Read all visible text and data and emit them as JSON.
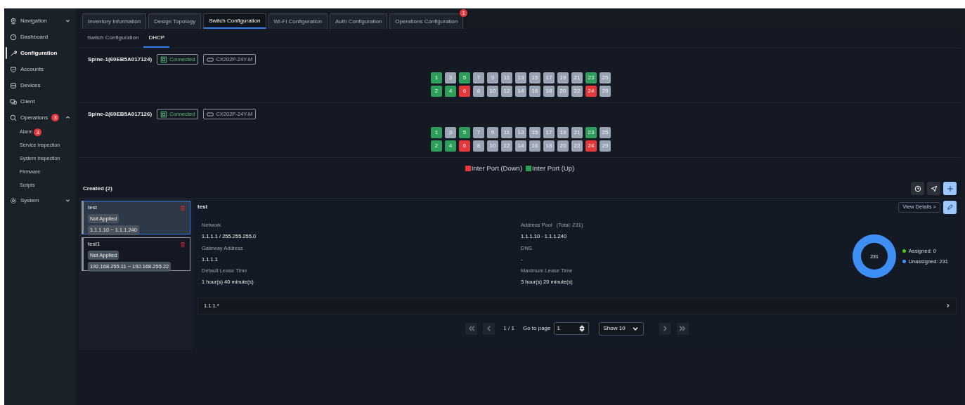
{
  "sidebar": {
    "items": [
      {
        "label": "Navigation",
        "kind": "group",
        "expanded": false,
        "selected": false
      },
      {
        "label": "Dashboard",
        "kind": "link",
        "selected": false
      },
      {
        "label": "Configuration",
        "kind": "link",
        "selected": true
      },
      {
        "label": "Accounts",
        "kind": "link",
        "selected": false
      },
      {
        "label": "Devices",
        "kind": "link",
        "selected": false
      },
      {
        "label": "Client",
        "kind": "link",
        "selected": false
      },
      {
        "label": "Operations",
        "kind": "group",
        "badge": "3",
        "expanded": true,
        "selected": false,
        "children": [
          {
            "label": "Alarm",
            "badge": "3",
            "selected": false
          },
          {
            "label": "Service Inspection",
            "selected": false
          },
          {
            "label": "System Inspection",
            "selected": false
          },
          {
            "label": "Firmware",
            "selected": false
          },
          {
            "label": "Scripts",
            "selected": false
          }
        ]
      },
      {
        "label": "System",
        "kind": "group",
        "expanded": false,
        "selected": false
      }
    ]
  },
  "tabs": [
    {
      "label": "Inventory Information",
      "selected": false
    },
    {
      "label": "Design Topology",
      "selected": false
    },
    {
      "label": "Switch Configuration",
      "selected": true
    },
    {
      "label": "Wi-Fi Configuration",
      "selected": false
    },
    {
      "label": "Auth Configuration",
      "selected": false
    },
    {
      "label": "Operations Configuration",
      "selected": false,
      "badge": "1"
    }
  ],
  "subtabs": [
    {
      "label": "Switch Configuration",
      "selected": false
    },
    {
      "label": "DHCP",
      "selected": true
    }
  ],
  "switches": [
    {
      "name": "Spine-1(60EB5A017124)",
      "status": "Connected",
      "model": "CX202P-24Y-M",
      "ports": [
        {
          "label": "1",
          "color": "#2e9e5b"
        },
        {
          "label": "2",
          "color": "#2e9e5b"
        },
        {
          "label": "3",
          "color": "#9ba4b3"
        },
        {
          "label": "4",
          "color": "#2e9e5b"
        },
        {
          "label": "5",
          "color": "#2e9e5b"
        },
        {
          "label": "6",
          "color": "#e5383b"
        },
        {
          "label": "7",
          "color": "#9ba4b3"
        },
        {
          "label": "8",
          "color": "#9ba4b3"
        },
        {
          "label": "9",
          "color": "#9ba4b3"
        },
        {
          "label": "10",
          "color": "#9ba4b3"
        },
        {
          "label": "11",
          "color": "#9ba4b3"
        },
        {
          "label": "12",
          "color": "#9ba4b3"
        },
        {
          "label": "13",
          "color": "#9ba4b3"
        },
        {
          "label": "14",
          "color": "#9ba4b3"
        },
        {
          "label": "15",
          "color": "#9ba4b3"
        },
        {
          "label": "16",
          "color": "#9ba4b3"
        },
        {
          "label": "17",
          "color": "#9ba4b3"
        },
        {
          "label": "18",
          "color": "#9ba4b3"
        },
        {
          "label": "19",
          "color": "#9ba4b3"
        },
        {
          "label": "20",
          "color": "#9ba4b3"
        },
        {
          "label": "21",
          "color": "#9ba4b3"
        },
        {
          "label": "22",
          "color": "#9ba4b3"
        },
        {
          "label": "23",
          "color": "#2e9e5b"
        },
        {
          "label": "24",
          "color": "#e5383b"
        },
        {
          "label": "25",
          "color": "#9ba4b3"
        },
        {
          "label": "29",
          "color": "#9ba4b3"
        }
      ]
    },
    {
      "name": "Spine-2(60EB5A017126)",
      "status": "Connected",
      "model": "CX202P-24Y-M",
      "ports": [
        {
          "label": "1",
          "color": "#2e9e5b"
        },
        {
          "label": "2",
          "color": "#2e9e5b"
        },
        {
          "label": "3",
          "color": "#9ba4b3"
        },
        {
          "label": "4",
          "color": "#2e9e5b"
        },
        {
          "label": "5",
          "color": "#2e9e5b"
        },
        {
          "label": "6",
          "color": "#e5383b"
        },
        {
          "label": "7",
          "color": "#9ba4b3"
        },
        {
          "label": "8",
          "color": "#9ba4b3"
        },
        {
          "label": "9",
          "color": "#9ba4b3"
        },
        {
          "label": "10",
          "color": "#9ba4b3"
        },
        {
          "label": "11",
          "color": "#9ba4b3"
        },
        {
          "label": "12",
          "color": "#9ba4b3"
        },
        {
          "label": "13",
          "color": "#9ba4b3"
        },
        {
          "label": "14",
          "color": "#9ba4b3"
        },
        {
          "label": "15",
          "color": "#9ba4b3"
        },
        {
          "label": "16",
          "color": "#9ba4b3"
        },
        {
          "label": "17",
          "color": "#9ba4b3"
        },
        {
          "label": "18",
          "color": "#9ba4b3"
        },
        {
          "label": "19",
          "color": "#9ba4b3"
        },
        {
          "label": "20",
          "color": "#9ba4b3"
        },
        {
          "label": "21",
          "color": "#9ba4b3"
        },
        {
          "label": "22",
          "color": "#9ba4b3"
        },
        {
          "label": "23",
          "color": "#2e9e5b"
        },
        {
          "label": "24",
          "color": "#e5383b"
        },
        {
          "label": "25",
          "color": "#9ba4b3"
        },
        {
          "label": "29",
          "color": "#9ba4b3"
        }
      ]
    }
  ],
  "legend": [
    {
      "label": "Inter Port (Down)",
      "color": "#e5383b"
    },
    {
      "label": "Inter Port (Up)",
      "color": "#2e9e5b"
    }
  ],
  "created": {
    "title": "Created (2)",
    "pools": [
      {
        "name": "test",
        "status": "Not Applied",
        "range": "1.1.1.10 ~ 1.1.1.240",
        "selected": true
      },
      {
        "name": "test1",
        "status": "Not Applied",
        "range": "192.168.255.11 ~ 192.168.255.22",
        "selected": false
      }
    ]
  },
  "detail": {
    "title": "test",
    "view_details": "View Details >",
    "fields": [
      {
        "label": "Network",
        "value": "1.1.1.1 / 255.255.255.0"
      },
      {
        "label": "Address Pool",
        "note": "(Total: 231)",
        "value": "1.1.1.10 - 1.1.1.240"
      },
      {
        "label": "Gateway Address",
        "value": "1.1.1.1"
      },
      {
        "label": "DNS",
        "value": "-"
      },
      {
        "label": "Default Lease Time",
        "value": "1 hour(s) 40 minute(s)"
      },
      {
        "label": "Maximum Lease Time",
        "value": "3 hour(s) 20 minute(s)"
      }
    ],
    "chart_data": {
      "type": "donut",
      "categories": [
        "Assigned: 0",
        "Unassigned: 231"
      ],
      "values": [
        0,
        231
      ]
    },
    "center_label": "231",
    "chart_legend": [
      {
        "color": "#52c41a"
      },
      {
        "color": "#3d8ff5"
      }
    ],
    "collapse_label": "1.1.1.*",
    "pager": {
      "page": "1 / 1",
      "goto_label": "Go to page",
      "goto_value": "1",
      "page_size": "Show 10"
    }
  }
}
